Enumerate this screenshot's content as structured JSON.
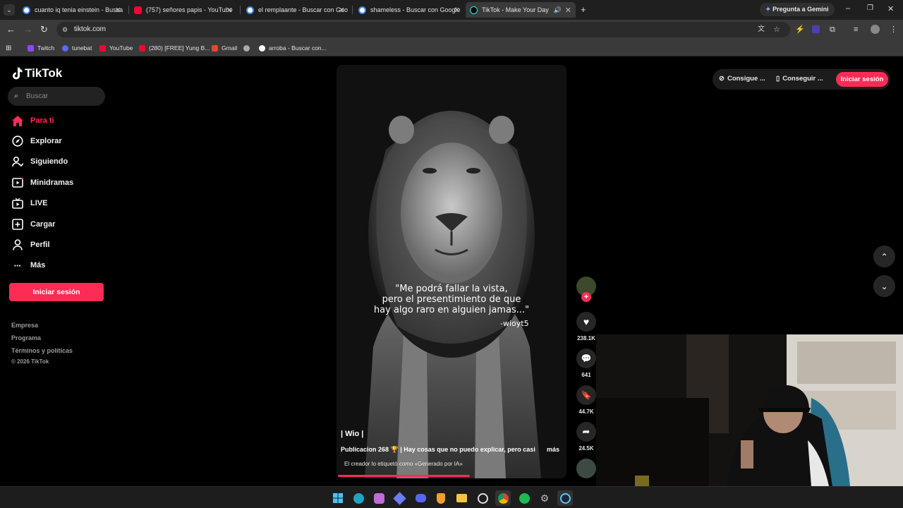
{
  "browser": {
    "tabs": [
      {
        "title": "cuanto iq tenia einstein - Busca",
        "favicon": "google-icon",
        "active": false
      },
      {
        "title": "(757) señores papis - YouTube",
        "favicon": "youtube-icon",
        "active": false
      },
      {
        "title": "el remplaante - Buscar con Goo",
        "favicon": "google-icon",
        "active": false
      },
      {
        "title": "shameless - Buscar con Google",
        "favicon": "google-icon",
        "active": false
      },
      {
        "title": "TikTok - Make Your Day",
        "favicon": "tiktok-icon",
        "active": true
      }
    ],
    "gemini_label": "Pregunta a Gemini",
    "url": "tiktok.com",
    "bookmarks": [
      {
        "label": "Twitch",
        "icon": "twitch-icon"
      },
      {
        "label": "tunebat",
        "icon": "tunebat-icon"
      },
      {
        "label": "YouTube",
        "icon": "youtube-icon"
      },
      {
        "label": "(280) [FREE] Yung B...",
        "icon": "youtube-icon"
      },
      {
        "label": "Gmail",
        "icon": "gmail-icon"
      },
      {
        "label": "",
        "icon": "globe-icon"
      },
      {
        "label": "arroba - Buscar con...",
        "icon": "google-icon"
      }
    ]
  },
  "tiktok": {
    "logo_text": "TikTok",
    "search_placeholder": "Buscar",
    "nav": [
      {
        "label": "Para ti",
        "icon": "home-icon",
        "active": true
      },
      {
        "label": "Explorar",
        "icon": "compass-icon",
        "active": false
      },
      {
        "label": "Siguiendo",
        "icon": "following-icon",
        "active": false
      },
      {
        "label": "Minidramas",
        "icon": "minidramas-icon",
        "active": false
      },
      {
        "label": "LIVE",
        "icon": "live-icon",
        "active": false
      },
      {
        "label": "Cargar",
        "icon": "upload-icon",
        "active": false
      },
      {
        "label": "Perfil",
        "icon": "profile-icon",
        "active": false
      },
      {
        "label": "Más",
        "icon": "more-icon",
        "active": false
      }
    ],
    "login_label": "Iniciar sesión",
    "footer": [
      "Empresa",
      "Programa",
      "Términos y políticas",
      "© 2026 TikTok"
    ],
    "top_actions": {
      "coins": "Consigue ...",
      "app": "Conseguir ...",
      "login": "Iniciar sesión"
    },
    "video": {
      "quote_lines": [
        "\"Me podrá fallar la vista,",
        "pero el presentimiento de que",
        "hay algo raro en alguien jamas...\""
      ],
      "signature": "-wioyt5",
      "author": "| Wio |",
      "caption": "Publicacion 268 🏆 | Hay cosas que no puedo explicar, pero casi",
      "more": "más",
      "ai_label": "El creador lo etiquetó como «Generado por IA»",
      "progress": 0.58
    },
    "actions": {
      "likes": "238.1K",
      "comments": "641",
      "saves": "44.7K",
      "shares": "24.5K"
    }
  },
  "colors": {
    "accent": "#fe2c55",
    "background": "#000000"
  }
}
